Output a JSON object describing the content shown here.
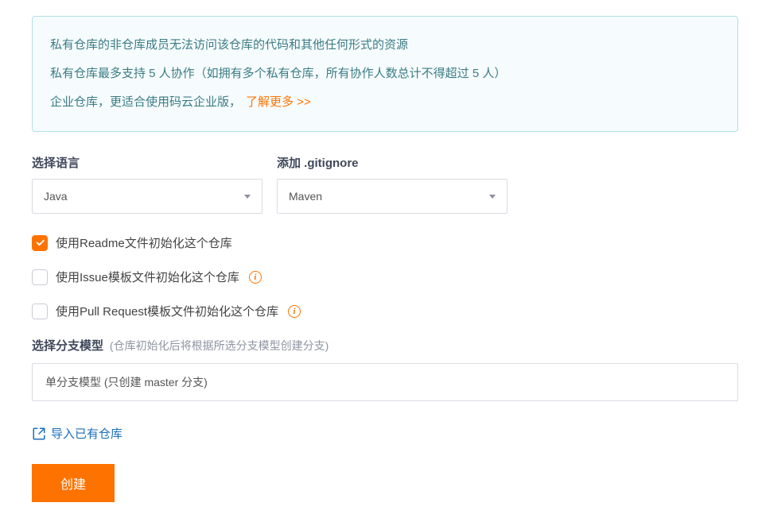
{
  "info": {
    "line1": "私有仓库的非仓库成员无法访问该仓库的代码和其他任何形式的资源",
    "line2": "私有仓库最多支持 5 人协作（如拥有多个私有仓库，所有协作人数总计不得超过 5 人）",
    "line3_prefix": "企业仓库，更适合使用码云企业版，",
    "learn_more": "了解更多 >>"
  },
  "language": {
    "label": "选择语言",
    "value": "Java"
  },
  "gitignore": {
    "label": "添加 .gitignore",
    "value": "Maven"
  },
  "checkboxes": {
    "readme": {
      "label": "使用Readme文件初始化这个仓库",
      "checked": true
    },
    "issue": {
      "label": "使用Issue模板文件初始化这个仓库",
      "checked": false
    },
    "pr": {
      "label": "使用Pull Request模板文件初始化这个仓库",
      "checked": false
    }
  },
  "branch": {
    "label": "选择分支模型",
    "hint": "(仓库初始化后将根据所选分支模型创建分支)",
    "value": "单分支模型 (只创建 master 分支)"
  },
  "import_link": "导入已有仓库",
  "create_button": "创建"
}
